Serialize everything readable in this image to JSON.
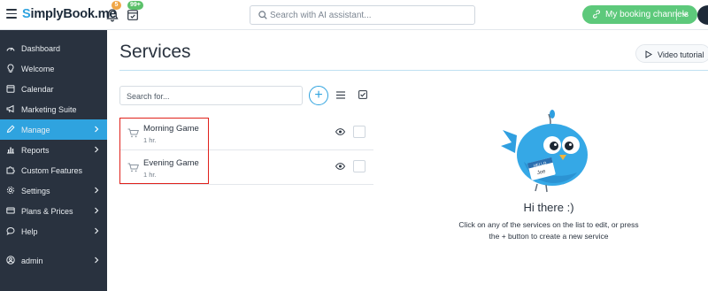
{
  "header": {
    "logo_text": "implyBook.me",
    "logo_initial": "S",
    "notification_count": "5",
    "tasks_count": "99+",
    "search_placeholder": "Search with AI assistant...",
    "booking_channels_label": "My booking channels"
  },
  "sidebar": {
    "items": [
      {
        "label": "Dashboard",
        "icon": "dashboard-icon"
      },
      {
        "label": "Welcome",
        "icon": "lightbulb-icon"
      },
      {
        "label": "Calendar",
        "icon": "calendar-icon"
      },
      {
        "label": "Marketing Suite",
        "icon": "megaphone-icon"
      },
      {
        "label": "Manage",
        "icon": "pencil-icon",
        "active": true
      },
      {
        "label": "Reports",
        "icon": "bar-chart-icon"
      },
      {
        "label": "Custom Features",
        "icon": "puzzle-icon"
      },
      {
        "label": "Settings",
        "icon": "gear-icon"
      },
      {
        "label": "Plans & Prices",
        "icon": "credit-card-icon"
      },
      {
        "label": "Help",
        "icon": "chat-bubble-icon"
      },
      {
        "label": "admin",
        "icon": "user-icon"
      }
    ]
  },
  "main": {
    "title": "Services",
    "video_tutorial_label": "Video tutorial",
    "search_placeholder": "Search for...",
    "add_label": "+",
    "services": [
      {
        "name": "Morning Game",
        "duration": "1 hr."
      },
      {
        "name": "Evening Game",
        "duration": "1 hr."
      }
    ],
    "empty_state": {
      "title": "Hi there :)",
      "line1": "Click on any of the services on the list to edit, or press",
      "line2": "the + button to create a new service",
      "badge_text_1": "HELLO",
      "badge_text_2": "Joe"
    }
  },
  "colors": {
    "accent": "#2fa3df",
    "sidebar_bg": "#29323f",
    "booking_button": "#5dc97b",
    "highlight_box": "#e0211b"
  }
}
